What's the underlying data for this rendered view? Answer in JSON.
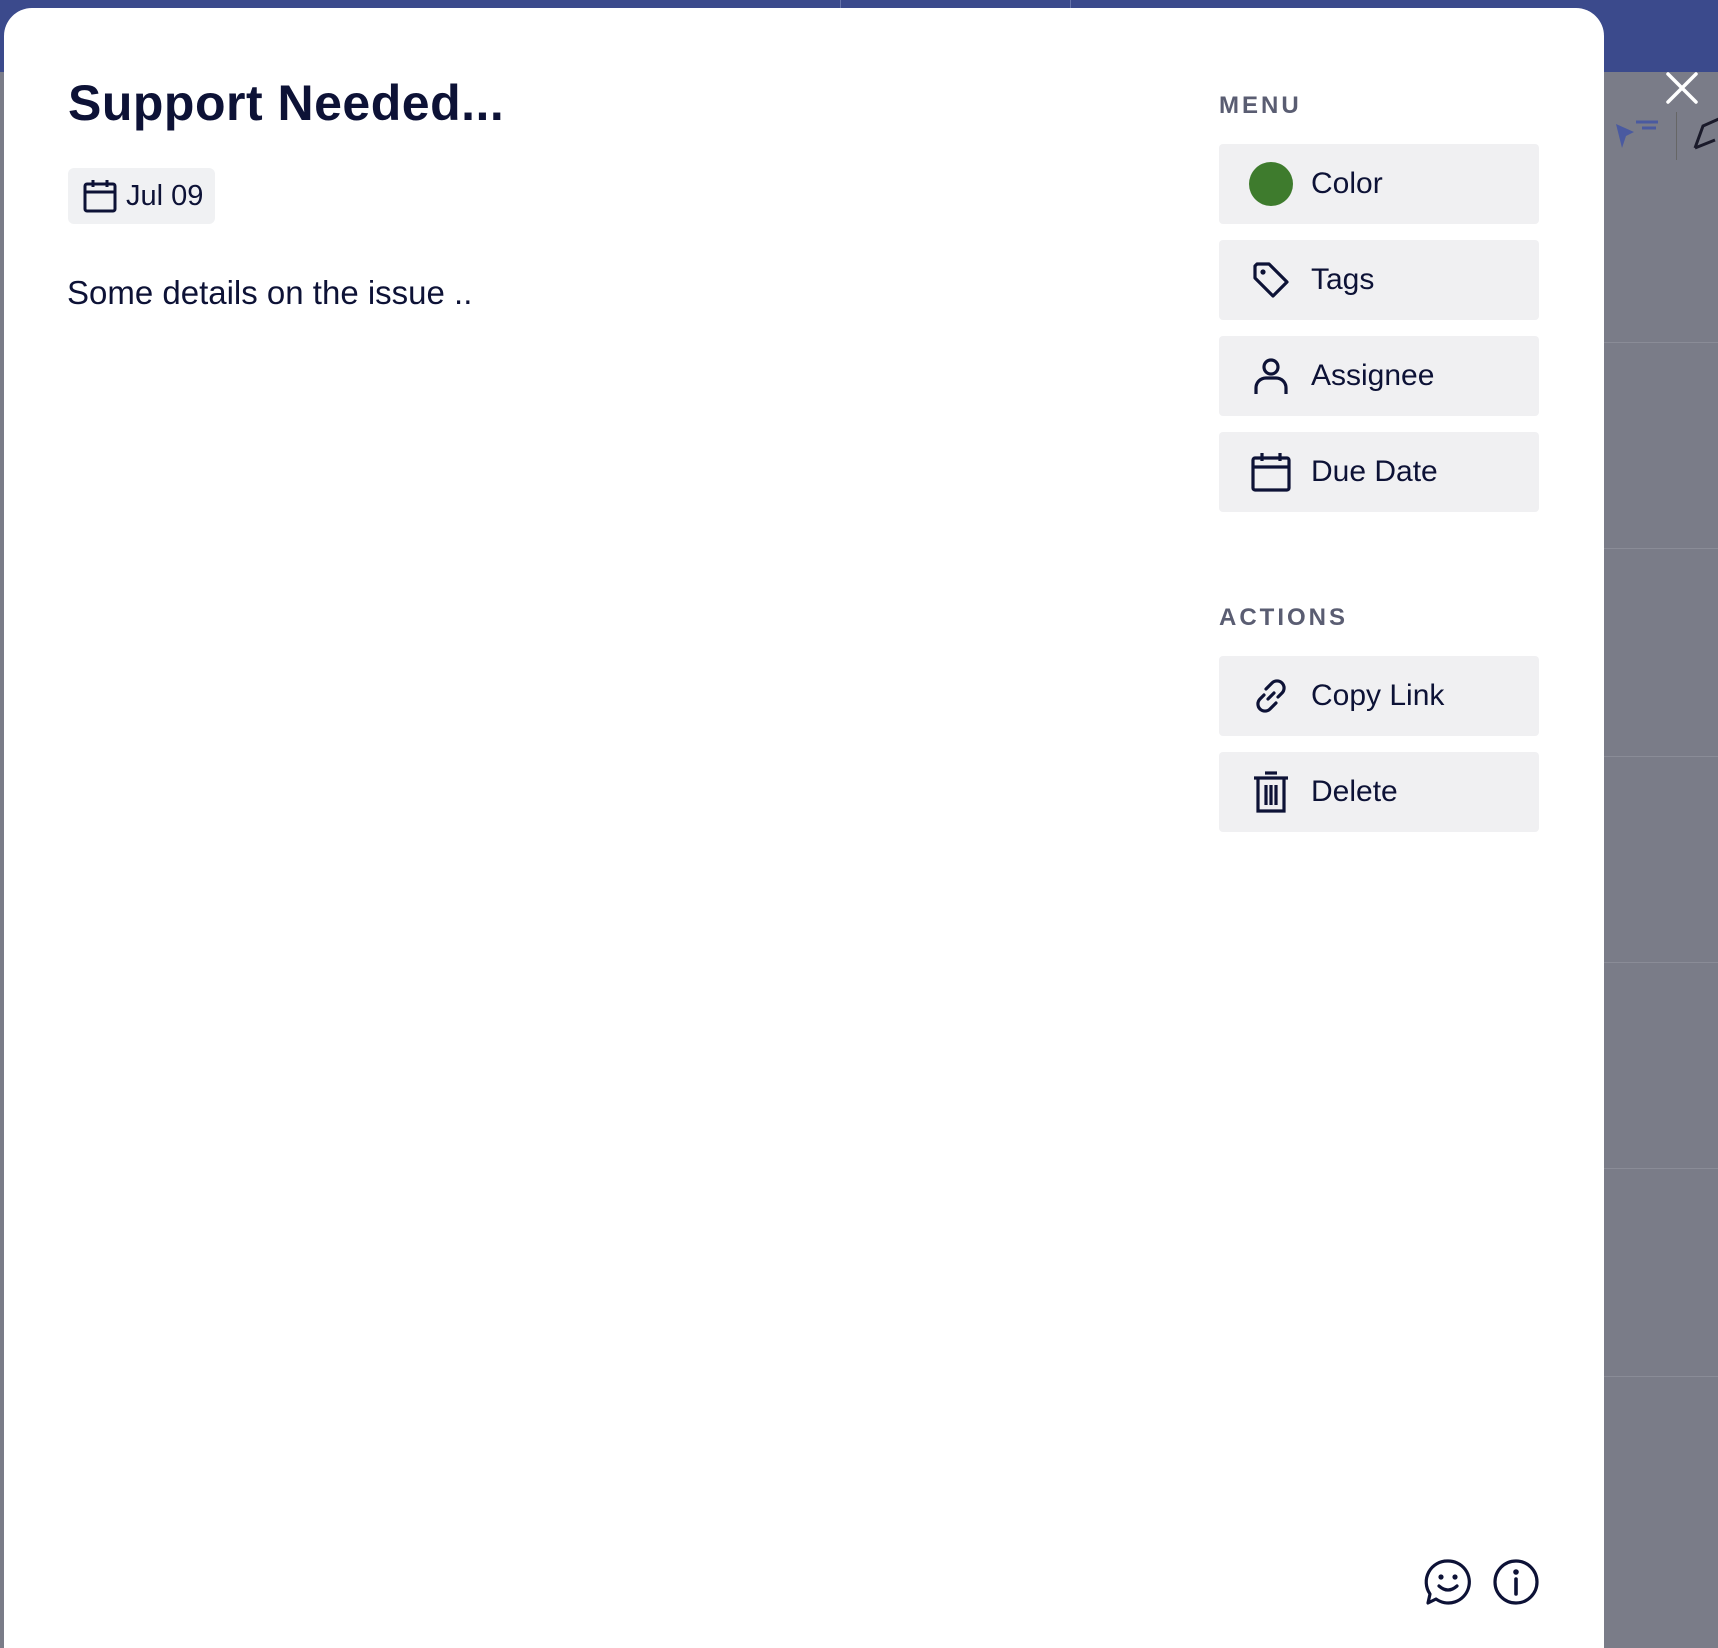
{
  "card": {
    "title": "Support Needed...",
    "date": "Jul 09",
    "description": "Some details on the issue .."
  },
  "sidebar": {
    "menu_label": "MENU",
    "menu_items": [
      {
        "label": "Color",
        "icon": "color-dot-icon"
      },
      {
        "label": "Tags",
        "icon": "tag-icon"
      },
      {
        "label": "Assignee",
        "icon": "person-icon"
      },
      {
        "label": "Due Date",
        "icon": "calendar-icon"
      }
    ],
    "actions_label": "ACTIONS",
    "action_items": [
      {
        "label": "Copy Link",
        "icon": "link-icon"
      },
      {
        "label": "Delete",
        "icon": "trash-icon"
      }
    ]
  },
  "colors": {
    "card_color": "#3e7b2d",
    "text": "#0d1236",
    "topbar": "#3b4a8c"
  },
  "footer_icons": [
    "feedback-icon",
    "info-icon"
  ]
}
